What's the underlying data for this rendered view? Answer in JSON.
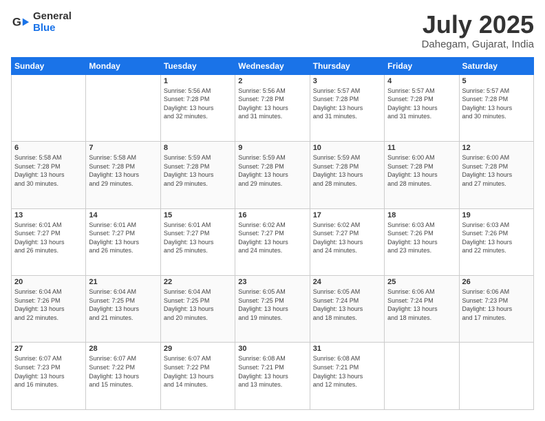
{
  "logo": {
    "general": "General",
    "blue": "Blue"
  },
  "header": {
    "month": "July 2025",
    "location": "Dahegam, Gujarat, India"
  },
  "weekdays": [
    "Sunday",
    "Monday",
    "Tuesday",
    "Wednesday",
    "Thursday",
    "Friday",
    "Saturday"
  ],
  "weeks": [
    [
      {
        "day": "",
        "info": ""
      },
      {
        "day": "",
        "info": ""
      },
      {
        "day": "1",
        "info": "Sunrise: 5:56 AM\nSunset: 7:28 PM\nDaylight: 13 hours\nand 32 minutes."
      },
      {
        "day": "2",
        "info": "Sunrise: 5:56 AM\nSunset: 7:28 PM\nDaylight: 13 hours\nand 31 minutes."
      },
      {
        "day": "3",
        "info": "Sunrise: 5:57 AM\nSunset: 7:28 PM\nDaylight: 13 hours\nand 31 minutes."
      },
      {
        "day": "4",
        "info": "Sunrise: 5:57 AM\nSunset: 7:28 PM\nDaylight: 13 hours\nand 31 minutes."
      },
      {
        "day": "5",
        "info": "Sunrise: 5:57 AM\nSunset: 7:28 PM\nDaylight: 13 hours\nand 30 minutes."
      }
    ],
    [
      {
        "day": "6",
        "info": "Sunrise: 5:58 AM\nSunset: 7:28 PM\nDaylight: 13 hours\nand 30 minutes."
      },
      {
        "day": "7",
        "info": "Sunrise: 5:58 AM\nSunset: 7:28 PM\nDaylight: 13 hours\nand 29 minutes."
      },
      {
        "day": "8",
        "info": "Sunrise: 5:59 AM\nSunset: 7:28 PM\nDaylight: 13 hours\nand 29 minutes."
      },
      {
        "day": "9",
        "info": "Sunrise: 5:59 AM\nSunset: 7:28 PM\nDaylight: 13 hours\nand 29 minutes."
      },
      {
        "day": "10",
        "info": "Sunrise: 5:59 AM\nSunset: 7:28 PM\nDaylight: 13 hours\nand 28 minutes."
      },
      {
        "day": "11",
        "info": "Sunrise: 6:00 AM\nSunset: 7:28 PM\nDaylight: 13 hours\nand 28 minutes."
      },
      {
        "day": "12",
        "info": "Sunrise: 6:00 AM\nSunset: 7:28 PM\nDaylight: 13 hours\nand 27 minutes."
      }
    ],
    [
      {
        "day": "13",
        "info": "Sunrise: 6:01 AM\nSunset: 7:27 PM\nDaylight: 13 hours\nand 26 minutes."
      },
      {
        "day": "14",
        "info": "Sunrise: 6:01 AM\nSunset: 7:27 PM\nDaylight: 13 hours\nand 26 minutes."
      },
      {
        "day": "15",
        "info": "Sunrise: 6:01 AM\nSunset: 7:27 PM\nDaylight: 13 hours\nand 25 minutes."
      },
      {
        "day": "16",
        "info": "Sunrise: 6:02 AM\nSunset: 7:27 PM\nDaylight: 13 hours\nand 24 minutes."
      },
      {
        "day": "17",
        "info": "Sunrise: 6:02 AM\nSunset: 7:27 PM\nDaylight: 13 hours\nand 24 minutes."
      },
      {
        "day": "18",
        "info": "Sunrise: 6:03 AM\nSunset: 7:26 PM\nDaylight: 13 hours\nand 23 minutes."
      },
      {
        "day": "19",
        "info": "Sunrise: 6:03 AM\nSunset: 7:26 PM\nDaylight: 13 hours\nand 22 minutes."
      }
    ],
    [
      {
        "day": "20",
        "info": "Sunrise: 6:04 AM\nSunset: 7:26 PM\nDaylight: 13 hours\nand 22 minutes."
      },
      {
        "day": "21",
        "info": "Sunrise: 6:04 AM\nSunset: 7:25 PM\nDaylight: 13 hours\nand 21 minutes."
      },
      {
        "day": "22",
        "info": "Sunrise: 6:04 AM\nSunset: 7:25 PM\nDaylight: 13 hours\nand 20 minutes."
      },
      {
        "day": "23",
        "info": "Sunrise: 6:05 AM\nSunset: 7:25 PM\nDaylight: 13 hours\nand 19 minutes."
      },
      {
        "day": "24",
        "info": "Sunrise: 6:05 AM\nSunset: 7:24 PM\nDaylight: 13 hours\nand 18 minutes."
      },
      {
        "day": "25",
        "info": "Sunrise: 6:06 AM\nSunset: 7:24 PM\nDaylight: 13 hours\nand 18 minutes."
      },
      {
        "day": "26",
        "info": "Sunrise: 6:06 AM\nSunset: 7:23 PM\nDaylight: 13 hours\nand 17 minutes."
      }
    ],
    [
      {
        "day": "27",
        "info": "Sunrise: 6:07 AM\nSunset: 7:23 PM\nDaylight: 13 hours\nand 16 minutes."
      },
      {
        "day": "28",
        "info": "Sunrise: 6:07 AM\nSunset: 7:22 PM\nDaylight: 13 hours\nand 15 minutes."
      },
      {
        "day": "29",
        "info": "Sunrise: 6:07 AM\nSunset: 7:22 PM\nDaylight: 13 hours\nand 14 minutes."
      },
      {
        "day": "30",
        "info": "Sunrise: 6:08 AM\nSunset: 7:21 PM\nDaylight: 13 hours\nand 13 minutes."
      },
      {
        "day": "31",
        "info": "Sunrise: 6:08 AM\nSunset: 7:21 PM\nDaylight: 13 hours\nand 12 minutes."
      },
      {
        "day": "",
        "info": ""
      },
      {
        "day": "",
        "info": ""
      }
    ]
  ]
}
